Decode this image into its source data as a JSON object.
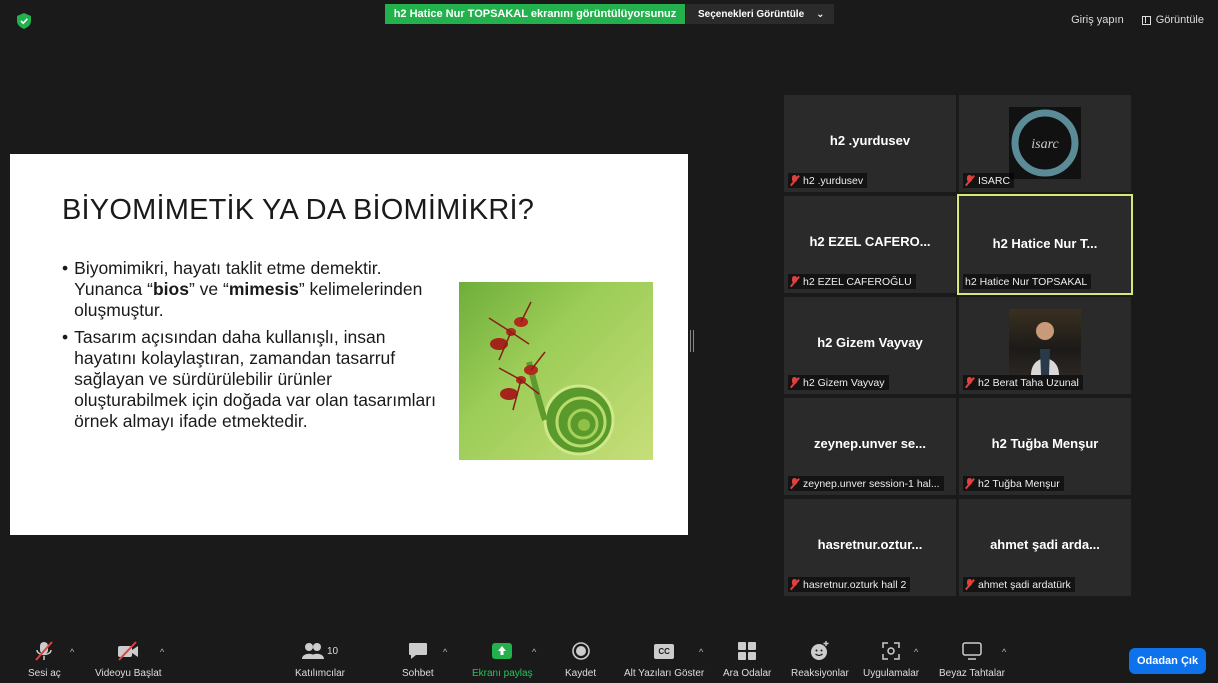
{
  "top_bar": {
    "share_banner": "h2 Hatice Nur TOPSAKAL ekranını görüntülüyorsunuz",
    "view_options": "Seçenekleri Görüntüle",
    "sign_in": "Giriş yapın",
    "view": "Görüntüle"
  },
  "slide": {
    "title": "BİYOMİMETİK YA DA BİOMİMİKRİ?",
    "bullet1_a": "Biyomimikri, hayatı taklit etme demektir. Yunanca “",
    "bullet1_b1": "bios",
    "bullet1_c": "” ve “",
    "bullet1_b2": "mimesis",
    "bullet1_d": "” kelimelerinden oluşmuştur.",
    "bullet2": "Tasarım açısından daha kullanışlı, insan hayatını kolaylaştıran, zamandan tasarruf sağlayan ve sürdürülebilir ürünler oluşturabilmek için doğada var olan tasarımları örnek almayı ifade etmektedir."
  },
  "participants": [
    {
      "name": "h2 .yurdusev",
      "label": "h2 .yurdusev",
      "muted": true
    },
    {
      "name": "",
      "label": "ISARC",
      "muted": true
    },
    {
      "name": "h2 EZEL CAFERO...",
      "label": "h2 EZEL CAFEROĞLU",
      "muted": true
    },
    {
      "name": "h2 Hatice Nur T...",
      "label": "h2 Hatice Nur TOPSAKAL",
      "muted": false
    },
    {
      "name": "h2 Gizem Vayvay",
      "label": "h2 Gizem Vayvay",
      "muted": true
    },
    {
      "name": "",
      "label": "h2 Berat Taha Uzunal",
      "muted": true
    },
    {
      "name": "zeynep.unver se...",
      "label": "zeynep.unver session-1 hal...",
      "muted": true
    },
    {
      "name": "h2 Tuğba Menşur",
      "label": "h2 Tuğba Menşur",
      "muted": true
    },
    {
      "name": "hasretnur.oztur...",
      "label": "hasretnur.ozturk hall 2",
      "muted": true
    },
    {
      "name": "ahmet şadi arda...",
      "label": "ahmet şadi ardatürk",
      "muted": true
    }
  ],
  "isarc_logo_text": "isarc",
  "toolbar": {
    "unmute": "Sesi aç",
    "start_video": "Videoyu Başlat",
    "participants": "Katılımcılar",
    "participant_count": "10",
    "chat": "Sohbet",
    "share_screen": "Ekranı paylaş",
    "record": "Kaydet",
    "captions": "Alt Yazıları Göster",
    "breakout": "Ara Odalar",
    "reactions": "Reaksiyonlar",
    "apps": "Uygulamalar",
    "whiteboards": "Beyaz Tahtalar",
    "leave": "Odadan Çık",
    "cc": "CC"
  },
  "colors": {
    "share_green": "#22b14c",
    "active_speaker": "#d6e87a",
    "leave_blue": "#0e72ed",
    "muted_red": "#e04040"
  }
}
